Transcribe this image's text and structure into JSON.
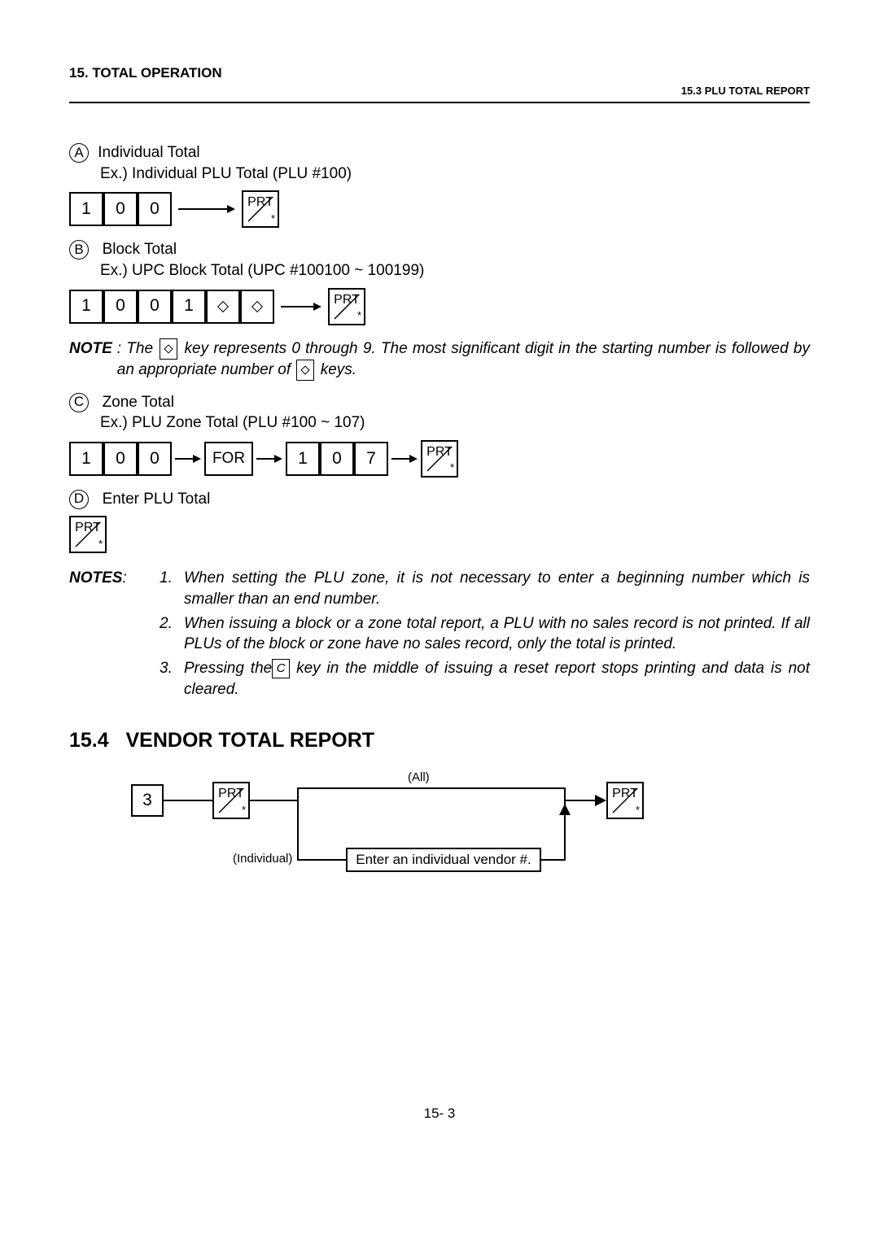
{
  "header": {
    "chapter": "15.  TOTAL OPERATION",
    "subright": "15.3 PLU TOTAL REPORT"
  },
  "labels": {
    "A": "A",
    "B": "B",
    "C": "C",
    "D": "D"
  },
  "sectA": {
    "title": "Individual Total",
    "ex": "Ex.) Individual PLU Total (PLU #100)",
    "keys": [
      "1",
      "0",
      "0"
    ]
  },
  "sectB": {
    "title": "Block Total",
    "ex": "Ex.) UPC Block Total (UPC #100100 ~ 100199)",
    "keys": [
      "1",
      "0",
      "0",
      "1"
    ]
  },
  "note1": {
    "label": "NOTE",
    "text1": ":  The ",
    "text2": " key represents 0 through 9.    The most significant digit in the starting number is followed by an appropriate number of ",
    "text3": "   keys."
  },
  "sectC": {
    "title": "Zone Total",
    "ex": "Ex.) PLU Zone Total (PLU #100 ~ 107)",
    "keys1": [
      "1",
      "0",
      "0"
    ],
    "for": "FOR",
    "keys2": [
      "1",
      "0",
      "7"
    ]
  },
  "sectD": {
    "title": "Enter PLU Total"
  },
  "prt": "PRT",
  "star": "*",
  "notes": {
    "label": "NOTES",
    "colon": ":",
    "items": [
      "When setting the PLU zone, it is not necessary to enter a beginning number which is smaller than an end number.",
      "When issuing a block or a zone total report, a PLU with no sales record is not printed.  If all PLUs of the block or zone have no sales record, only the total is printed.",
      "Pressing the|C| key in the middle of issuing a reset report stops printing and data is not cleared."
    ]
  },
  "section154": "15.4   VENDOR TOTAL REPORT",
  "vendor": {
    "key3": "3",
    "all": "(All)",
    "individual": "(Individual)",
    "enterbox": "Enter an individual vendor #."
  },
  "pagenum": "15- 3",
  "ckey": "C"
}
